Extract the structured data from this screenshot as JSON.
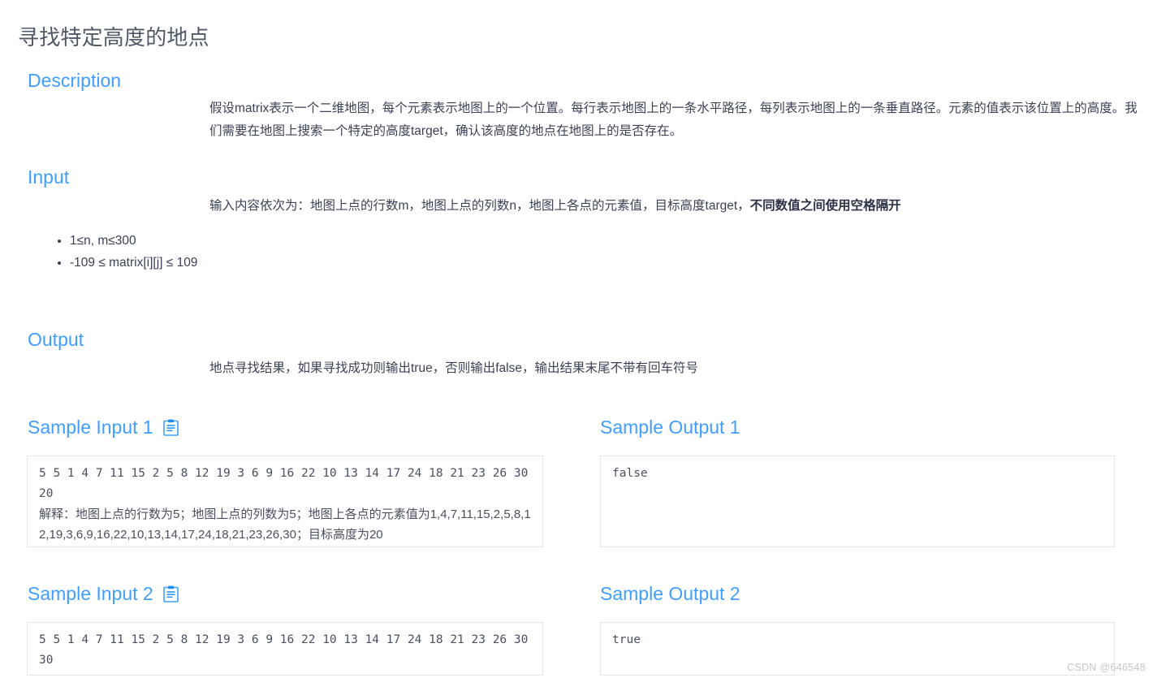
{
  "page": {
    "title": "寻找特定高度的地点",
    "watermark": "CSDN @646548",
    "accent_color": "#409eff",
    "title_color": "#4f5968",
    "text_color": "#3b4256",
    "code_border_color": "#e6e6e6"
  },
  "sections": {
    "description": {
      "heading": "Description",
      "paragraph": "假设matrix表示一个二维地图，每个元素表示地图上的一个位置。每行表示地图上的一条水平路径，每列表示地图上的一条垂直路径。元素的值表示该位置上的高度。我们需要在地图上搜索一个特定的高度target，确认该高度的地点在地图上的是否存在。"
    },
    "input": {
      "heading": "Input",
      "paragraph_normal": "输入内容依次为：地图上点的行数m，地图上点的列数n，地图上各点的元素值，目标高度target，",
      "paragraph_bold": "不同数值之间使用空格隔开",
      "constraints": [
        "1≤n, m≤300",
        "-109 ≤ matrix[i][j] ≤ 109"
      ]
    },
    "output": {
      "heading": "Output",
      "paragraph": "地点寻找结果，如果寻找成功则输出true，否则输出false，输出结果末尾不带有回车符号"
    }
  },
  "samples": [
    {
      "input_label": "Sample Input 1",
      "copy_icon": "clipboard-copy-icon",
      "input_lines": [
        "5 5 1 4 7 11 15 2 5 8 12 19 3 6 9 16 22 10 13 14 17 24 18 21 23 26 30",
        "20"
      ],
      "input_explanation_prefix": "解释：地图上点的行数为",
      "input_explanation": "解释：地图上点的行数为5；地图上点的列数为5；地图上各点的元素值为1,4,7,11,15,2,5,8,12,19,3,6,9,16,22,10,13,14,17,24,18,21,23,26,30；目标高度为20",
      "output_label": "Sample Output 1",
      "output_lines": [
        "false"
      ]
    },
    {
      "input_label": "Sample Input 2",
      "copy_icon": "clipboard-copy-icon",
      "input_lines": [
        "5 5 1 4 7 11 15 2 5 8 12 19 3 6 9 16 22 10 13 14 17 24 18 21 23 26 30",
        "30"
      ],
      "input_explanation": "",
      "output_label": "Sample Output 2",
      "output_lines": [
        "true"
      ]
    }
  ]
}
